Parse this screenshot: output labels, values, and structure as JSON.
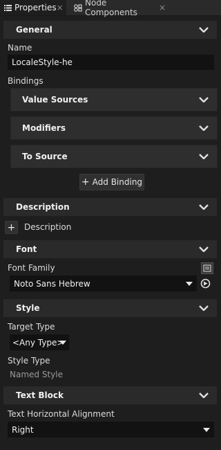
{
  "tabs": [
    {
      "label": "Properties",
      "icon": "list-icon",
      "close": "×"
    },
    {
      "label": "Node Components",
      "icon": "node-components-icon",
      "close": "×"
    }
  ],
  "sections": {
    "general": "General",
    "description": "Description",
    "font": "Font",
    "style": "Style",
    "text_block": "Text Block"
  },
  "general": {
    "name_label": "Name",
    "name_value": "LocaleStyle-he",
    "bindings_label": "Bindings",
    "bindings": [
      "Value Sources",
      "Modifiers",
      "To Source"
    ],
    "add_binding_label": "Add Binding"
  },
  "description": {
    "add_label": "Description"
  },
  "font": {
    "family_label": "Font Family",
    "family_value": "Noto Sans Hebrew"
  },
  "style": {
    "target_type_label": "Target Type",
    "target_type_value": "<Any Type>",
    "style_type_label": "Style Type",
    "style_type_value": "Named Style"
  },
  "text_block": {
    "halign_label": "Text Horizontal Alignment",
    "halign_value": "Right"
  },
  "colors": {
    "background": "#1e1e1e",
    "section": "#2a2a2a",
    "field": "#121212"
  }
}
